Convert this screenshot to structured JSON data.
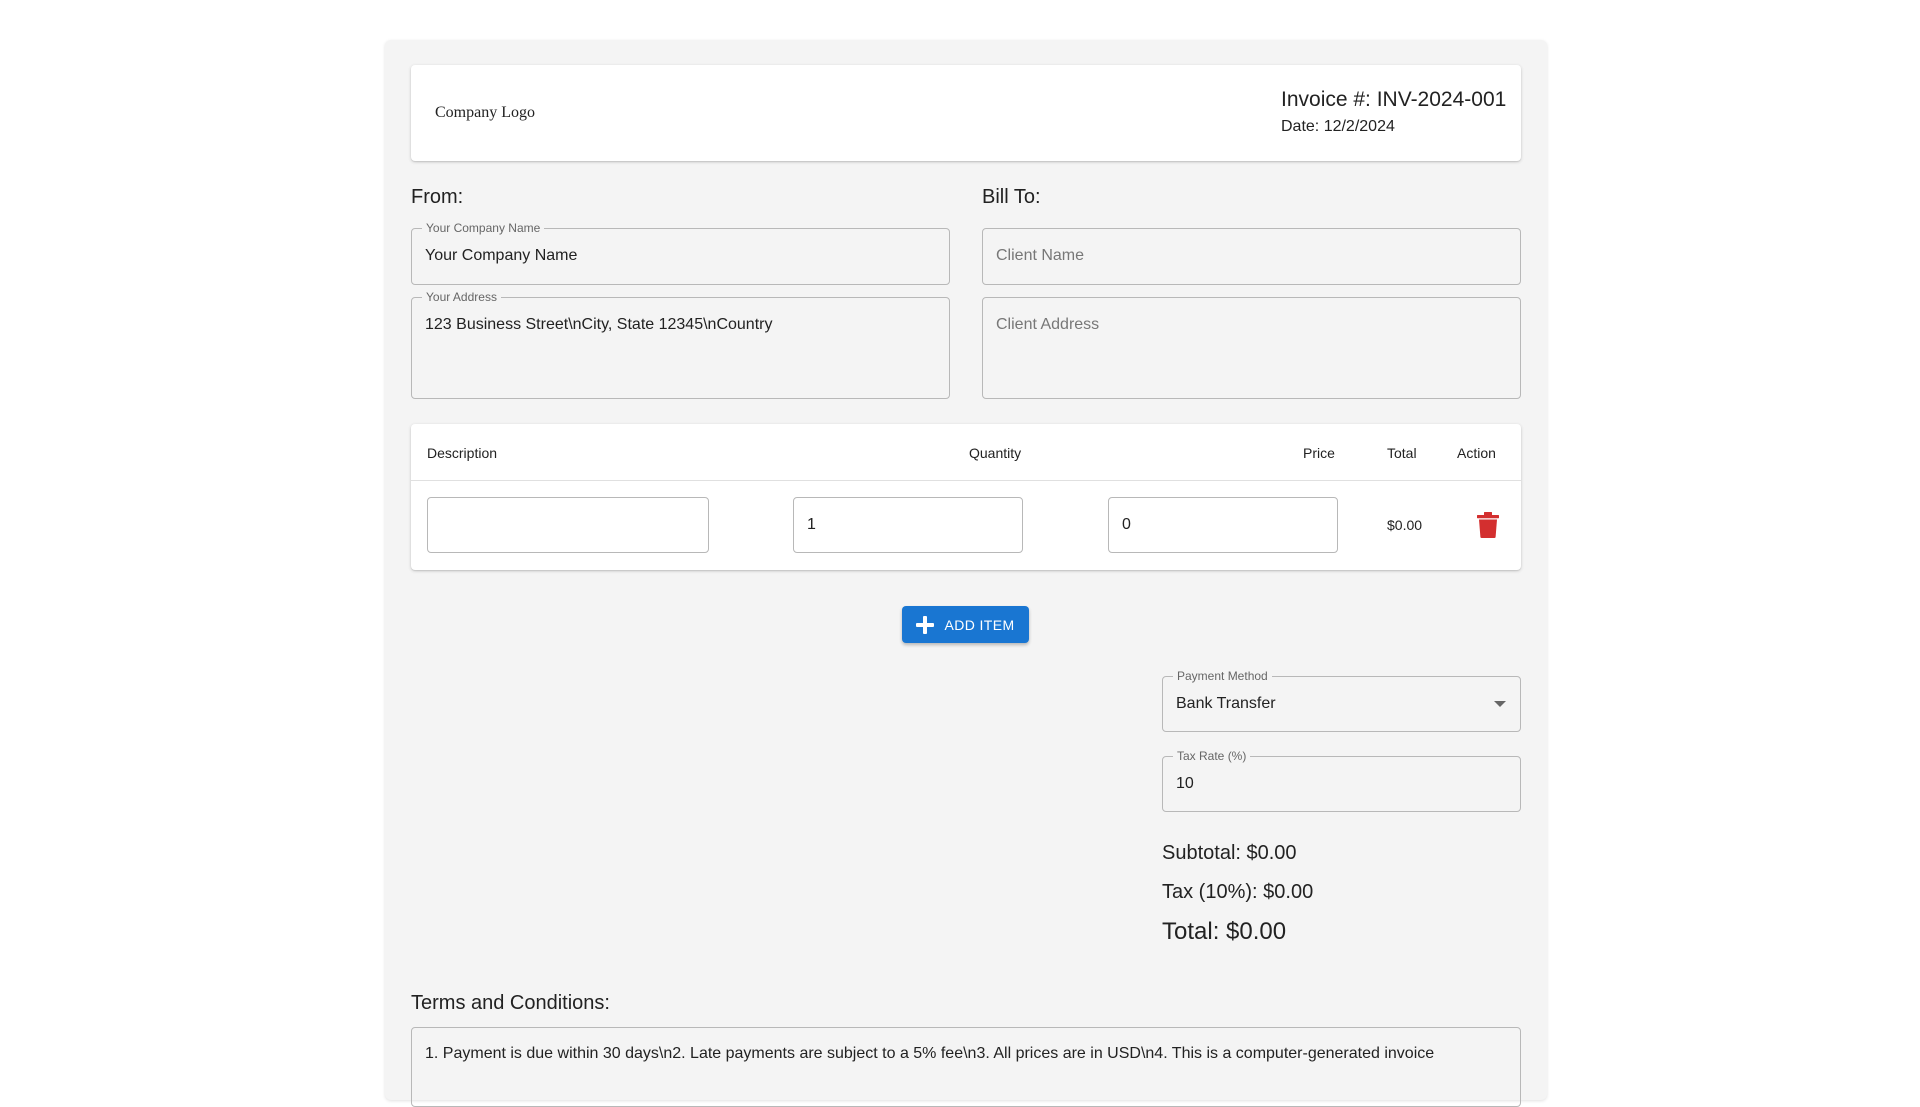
{
  "header": {
    "logo_alt": "Company Logo",
    "invoice_number": "Invoice #: INV-2024-001",
    "date": "Date: 12/2/2024"
  },
  "from": {
    "title": "From:",
    "company_label": "Your Company Name",
    "company_value": "Your Company Name",
    "address_label": "Your Address",
    "address_value": "123 Business Street\\nCity, State 12345\\nCountry"
  },
  "bill_to": {
    "title": "Bill To:",
    "client_name_placeholder": "Client Name",
    "client_address_placeholder": "Client Address"
  },
  "items_table": {
    "headers": {
      "description": "Description",
      "quantity": "Quantity",
      "price": "Price",
      "total": "Total",
      "action": "Action"
    },
    "rows": [
      {
        "description": "",
        "quantity": "1",
        "price": "0",
        "total": "$0.00"
      }
    ]
  },
  "add_item_label": "ADD ITEM",
  "payment": {
    "label": "Payment Method",
    "value": "Bank Transfer"
  },
  "tax": {
    "label": "Tax Rate (%)",
    "value": "10"
  },
  "summary": {
    "subtotal": "Subtotal: $0.00",
    "tax": "Tax (10%): $0.00",
    "total": "Total: $0.00"
  },
  "terms": {
    "title": "Terms and Conditions:",
    "value": "1. Payment is due within 30 days\\n2. Late payments are subject to a 5% fee\\n3. All prices are in USD\\n4. This is a computer-generated invoice"
  },
  "colors": {
    "primary": "#1976d2",
    "delete": "#d32f2f",
    "paper_bg": "#f4f4f4"
  },
  "icons": {
    "add": "plus-icon",
    "delete": "trash-icon",
    "select": "caret-down-icon",
    "logo": "broken-image-icon"
  }
}
